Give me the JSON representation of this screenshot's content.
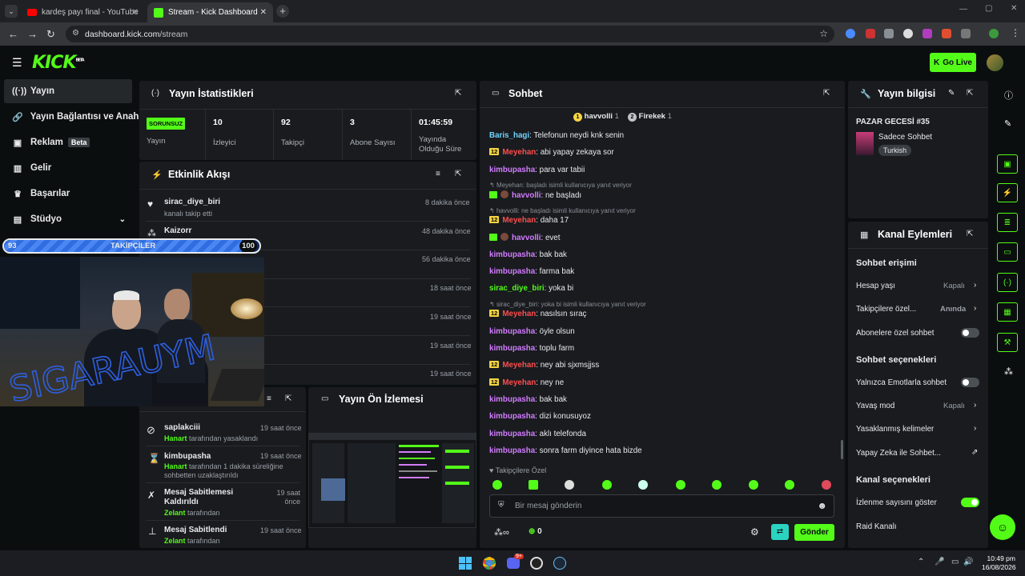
{
  "browser": {
    "tabs": [
      {
        "title": "kardeş payı final - YouTube",
        "active": false
      },
      {
        "title": "Stream - Kick Dashboard",
        "active": true
      }
    ],
    "url_host": "dashboard.kick.com",
    "url_path": "/stream"
  },
  "header": {
    "logo": "KICK",
    "logo_tag": "BETA",
    "go_live": "Go Live"
  },
  "nav": {
    "items": [
      {
        "label": "Yayın",
        "icon": "broadcast-icon"
      },
      {
        "label": "Yayın Bağlantısı ve Anahtar",
        "icon": "link-icon"
      },
      {
        "label": "Reklam",
        "icon": "ad-icon",
        "badge": "Beta"
      },
      {
        "label": "Gelir",
        "icon": "chart-icon"
      },
      {
        "label": "Başarılar",
        "icon": "trophy-icon"
      },
      {
        "label": "Stüdyo",
        "icon": "studio-icon"
      }
    ]
  },
  "overlay": {
    "followers_start": "93",
    "followers_label": "TAKİPÇİLER",
    "followers_goal": "100",
    "progress_fraction": 0.93,
    "scribble_text": "SIGARAUYM"
  },
  "stats": {
    "title": "Yayın İstatistikleri",
    "health_badge": "SORUNSUZ",
    "health_label": "Yayın",
    "items": [
      {
        "value": "10",
        "label": "İzleyici"
      },
      {
        "value": "92",
        "label": "Takipçi"
      },
      {
        "value": "3",
        "label": "Abone Sayısı"
      },
      {
        "value": "01:45:59",
        "label": "Yayında Olduğu Süre"
      }
    ]
  },
  "activity": {
    "title": "Etkinlik Akışı",
    "items": [
      {
        "user": "sirac_diye_biri",
        "sub": "kanalı takip etti",
        "time": "8 dakika önce"
      },
      {
        "user": "Kaizorr",
        "sub": "",
        "time": "48 dakika önce"
      },
      {
        "user": "",
        "sub": "",
        "time": "56 dakika önce"
      },
      {
        "user": "",
        "sub": "",
        "time": "18 saat önce"
      },
      {
        "user": "",
        "sub": "",
        "time": "19 saat önce"
      },
      {
        "user": "",
        "sub": "",
        "time": "19 saat önce"
      },
      {
        "user": "",
        "sub": "",
        "time": "19 saat önce"
      }
    ]
  },
  "modlog": {
    "items": [
      {
        "title": "saplakciii",
        "actor": "Hanart",
        "desc": "tarafından yasaklandı",
        "time": "19 saat önce"
      },
      {
        "title": "kimbupasha",
        "actor": "Hanart",
        "desc": "tarafından 1 dakika süreliğine sohbetten uzaklaştırıldı",
        "time": "19 saat önce"
      },
      {
        "title": "Mesaj Sabitlemesi Kaldırıldı",
        "actor": "Zelant",
        "desc": "tarafından",
        "time": "19 saat önce"
      },
      {
        "title": "Mesaj Sabitlendi",
        "actor": "Zelant",
        "desc": "tarafından",
        "time": "19 saat önce"
      }
    ]
  },
  "preview": {
    "title": "Yayın Ön İzlemesi"
  },
  "chat": {
    "title": "Sohbet",
    "top_gifters": [
      {
        "rank": "1",
        "name": "havvolli",
        "count": "1"
      },
      {
        "rank": "2",
        "name": "Firekek",
        "count": "1"
      }
    ],
    "messages": [
      {
        "user": "Baris_hagi",
        "color": "blue",
        "text": "Telefonun neydi knk senin"
      },
      {
        "user": "Meyehan",
        "color": "red",
        "badge": "12",
        "text": "abi yapay zekaya sor"
      },
      {
        "user": "kimbupasha",
        "color": "purple",
        "text": "para var tabii"
      },
      {
        "reply": "Meyehan: başladı isimli kullanıcıya yanıt veriyor"
      },
      {
        "user": "havvolli",
        "color": "purple",
        "mod": true,
        "text": "ne başladı"
      },
      {
        "reply": "havvolli: ne başladı isimli kullanıcıya yanıt veriyor"
      },
      {
        "user": "Meyehan",
        "color": "red",
        "badge": "12",
        "text": "daha 17"
      },
      {
        "user": "havvolli",
        "color": "purple",
        "mod": true,
        "text": "evet"
      },
      {
        "user": "kimbupasha",
        "color": "purple",
        "text": "bak bak"
      },
      {
        "user": "kimbupasha",
        "color": "purple",
        "text": "farma bak"
      },
      {
        "user": "sirac_diye_biri",
        "color": "green",
        "text": "yoka bi"
      },
      {
        "reply": "sirac_diye_biri: yoka bi isimli kullanıcıya yanıt veriyor"
      },
      {
        "user": "Meyehan",
        "color": "red",
        "badge": "12",
        "text": "nasılsın sıraç"
      },
      {
        "user": "kimbupasha",
        "color": "purple",
        "text": "öyle olsun"
      },
      {
        "user": "kimbupasha",
        "color": "purple",
        "text": "toplu farm"
      },
      {
        "user": "Meyehan",
        "color": "red",
        "badge": "12",
        "text": "ney abi sjxmsjjss"
      },
      {
        "user": "Meyehan",
        "color": "red",
        "badge": "12",
        "text": "ney ne"
      },
      {
        "user": "kimbupasha",
        "color": "purple",
        "text": "bak bak"
      },
      {
        "user": "kimbupasha",
        "color": "purple",
        "text": "dizi konusuyoz"
      },
      {
        "user": "kimbupasha",
        "color": "purple",
        "text": "aklı telefonda"
      },
      {
        "user": "kimbupasha",
        "color": "purple",
        "text": "sonra farm diyince hata bizde"
      }
    ],
    "followers_only": "Takipçilere Özel",
    "input_placeholder": "Bir mesaj gönderin",
    "infinity": "∞",
    "points": "0",
    "send": "Gönder"
  },
  "stream_info": {
    "title": "Yayın bilgisi",
    "stream_title": "PAZAR GECESİ #35",
    "category": "Sadece Sohbet",
    "tag": "Turkish"
  },
  "channel_actions": {
    "title": "Kanal Eylemleri",
    "chat_access": "Sohbet erişimi",
    "account_age": "Hesap yaşı",
    "account_age_value": "Kapalı",
    "followers_only": "Takipçilere özel...",
    "followers_only_value": "Anında",
    "subs_only": "Abonelere özel sohbet",
    "chat_options": "Sohbet seçenekleri",
    "emote_only": "Yalnızca Emotlarla sohbet",
    "slow_mode": "Yavaş mod",
    "slow_mode_value": "Kapalı",
    "banned_words": "Yasaklanmış kelimeler",
    "ai": "Yapay Zeka ile Sohbet...",
    "channel_options": "Kanal seçenekleri",
    "show_viewers": "İzlenme sayısını göster",
    "raid": "Raid Kanalı"
  },
  "taskbar": {
    "time": "10:49 pm",
    "date": "16/08/2026",
    "discord_badge": "9+"
  },
  "colors": {
    "accent": "#53fc18",
    "panel": "#191b1f",
    "bg": "#0b0e0f"
  }
}
